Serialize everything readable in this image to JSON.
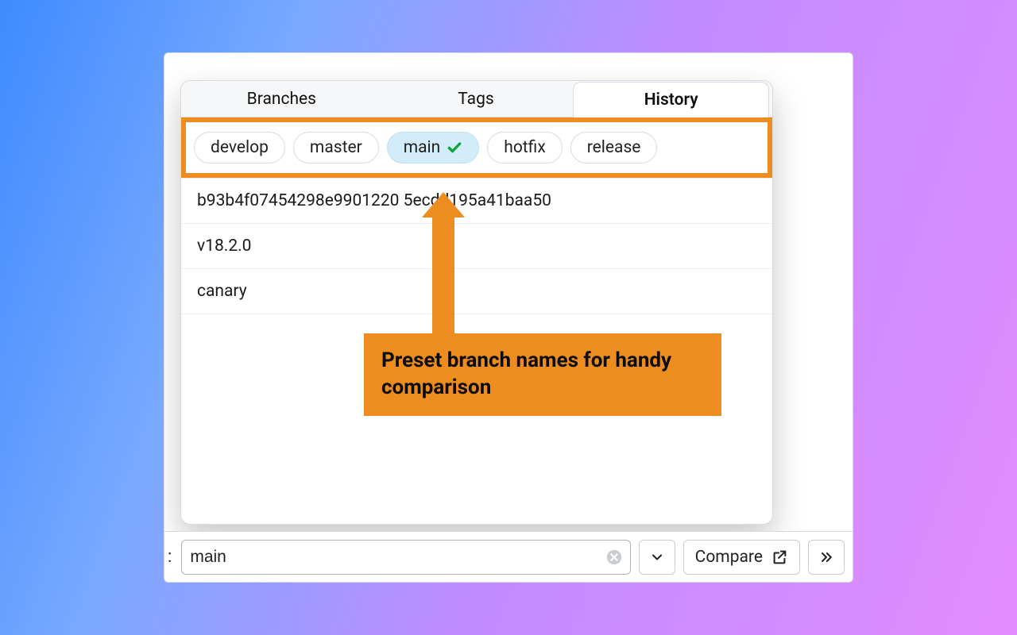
{
  "tabs": {
    "branches": "Branches",
    "tags": "Tags",
    "history": "History"
  },
  "branch_chips": [
    {
      "label": "develop",
      "selected": false
    },
    {
      "label": "master",
      "selected": false
    },
    {
      "label": "main",
      "selected": true
    },
    {
      "label": "hotfix",
      "selected": false
    },
    {
      "label": "release",
      "selected": false
    }
  ],
  "history_items": [
    "b93b4f07454298e9901220  5ecdd195a41baa50",
    "v18.2.0",
    "canary"
  ],
  "callout": "Preset branch names for handy comparison",
  "input": {
    "value": "main"
  },
  "compare_label": "Compare",
  "colon": ":"
}
